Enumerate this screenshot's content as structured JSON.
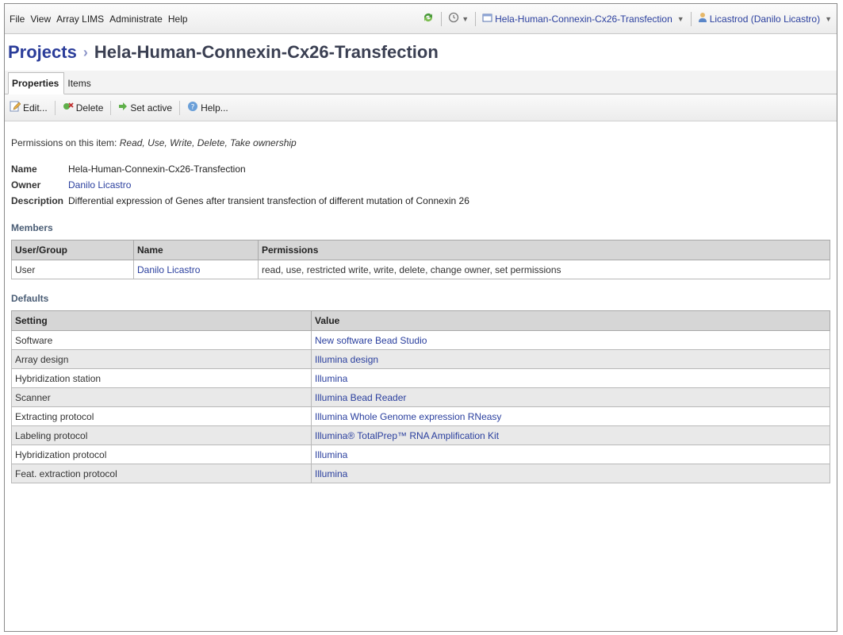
{
  "menubar": {
    "items": [
      "File",
      "View",
      "Array LIMS",
      "Administrate",
      "Help"
    ],
    "active_project": "Hela-Human-Connexin-Cx26-Transfection",
    "user": "Licastrod (Danilo Licastro)"
  },
  "title": {
    "crumb": "Projects",
    "current": "Hela-Human-Connexin-Cx26-Transfection"
  },
  "tabs": [
    "Properties",
    "Items"
  ],
  "toolbar": {
    "edit": "Edit...",
    "delete": "Delete",
    "set_active": "Set active",
    "help": "Help..."
  },
  "permissions_label": "Permissions on this item:",
  "permissions_value": "Read, Use, Write, Delete, Take ownership",
  "properties": {
    "name_label": "Name",
    "name_value": "Hela-Human-Connexin-Cx26-Transfection",
    "owner_label": "Owner",
    "owner_value": "Danilo Licastro",
    "description_label": "Description",
    "description_value": "Differential expression of Genes after transient transfection of different mutation of Connexin 26"
  },
  "members": {
    "section": "Members",
    "headers": [
      "User/Group",
      "Name",
      "Permissions"
    ],
    "rows": [
      [
        "User",
        "Danilo Licastro",
        "read, use, restricted write, write, delete, change owner, set permissions"
      ]
    ]
  },
  "defaults": {
    "section": "Defaults",
    "headers": [
      "Setting",
      "Value"
    ],
    "rows": [
      [
        "Software",
        "New software Bead Studio"
      ],
      [
        "Array design",
        "Illumina design"
      ],
      [
        "Hybridization station",
        "Illumina"
      ],
      [
        "Scanner",
        "Illumina Bead Reader"
      ],
      [
        "Extracting protocol",
        "Illumina Whole Genome expression RNeasy"
      ],
      [
        "Labeling protocol",
        "Illumina® TotalPrep™ RNA Amplification Kit"
      ],
      [
        "Hybridization protocol",
        "Illumina"
      ],
      [
        "Feat. extraction protocol",
        "Illumina"
      ]
    ]
  },
  "colors": {
    "link": "#2a3f9e",
    "header_bg": "#d6d6d6",
    "alt_row": "#e9e9e9"
  }
}
